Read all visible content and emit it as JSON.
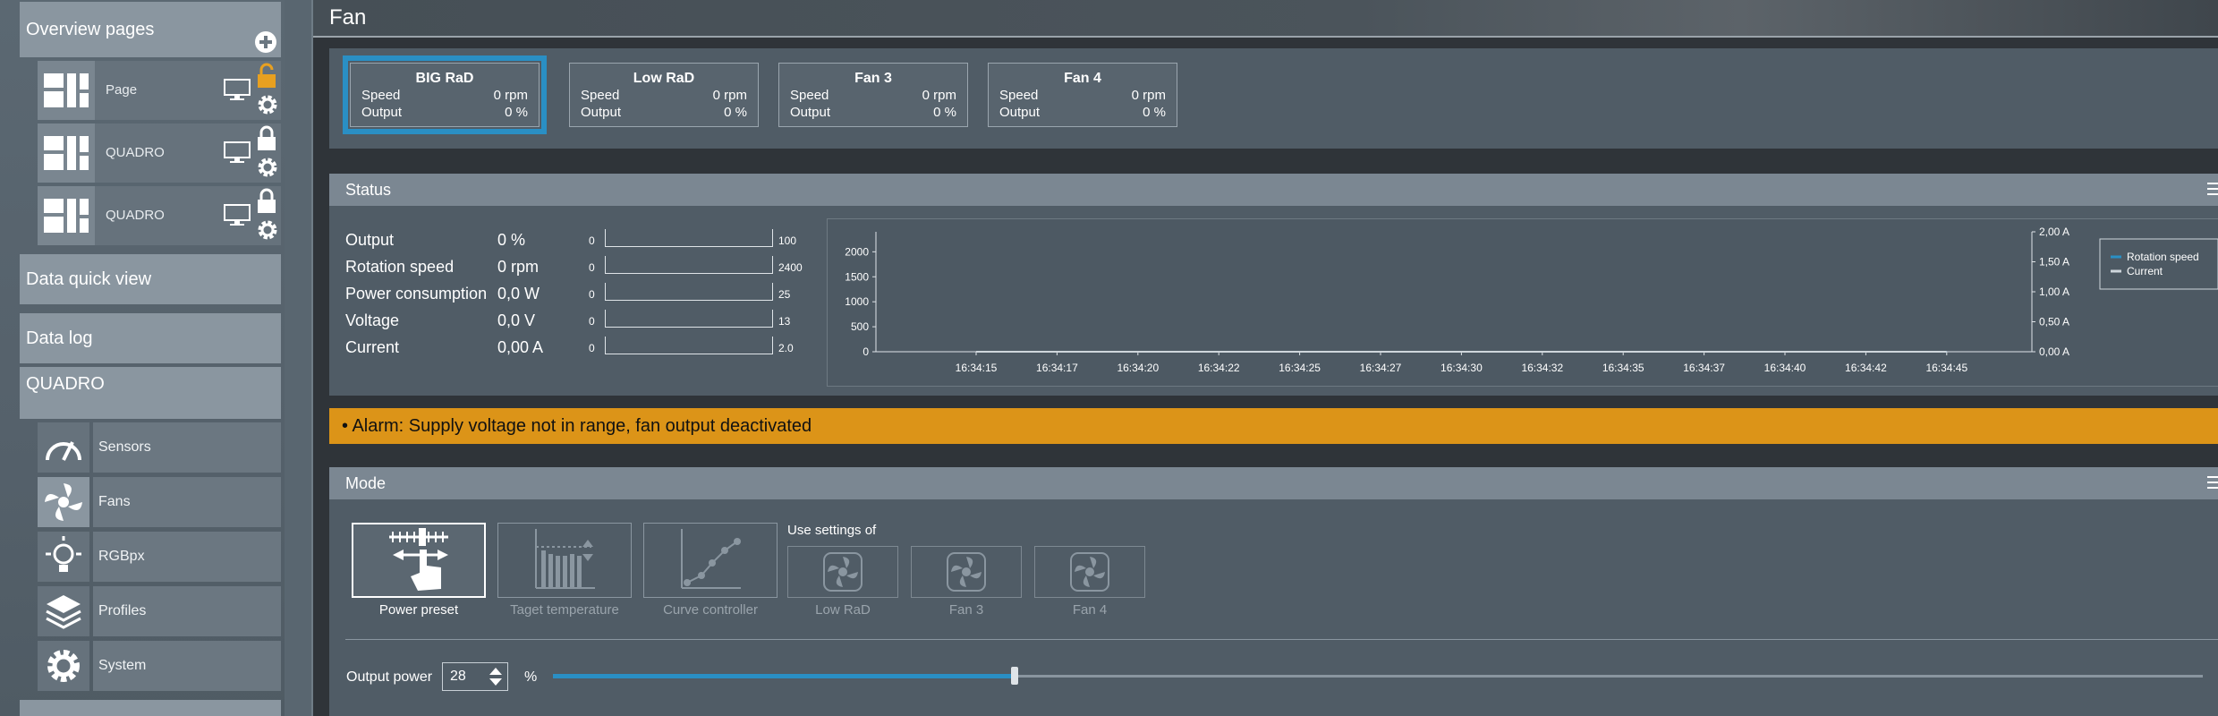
{
  "sidebar": {
    "overview_title": "Overview pages",
    "pages": [
      {
        "label": "Page"
      },
      {
        "label": "QUADRO"
      },
      {
        "label": "QUADRO"
      }
    ],
    "data_quick_view": "Data quick view",
    "data_log": "Data log",
    "device": "QUADRO",
    "items": [
      {
        "label": "Sensors",
        "icon": "gauge-icon"
      },
      {
        "label": "Fans",
        "icon": "fan-icon"
      },
      {
        "label": "RGBpx",
        "icon": "bulb-icon"
      },
      {
        "label": "Profiles",
        "icon": "layers-icon"
      },
      {
        "label": "System",
        "icon": "gear-icon"
      }
    ]
  },
  "header": {
    "title": "Fan"
  },
  "fans": [
    {
      "name": "BIG RaD",
      "speed_label": "Speed",
      "speed": "0 rpm",
      "output_label": "Output",
      "output": "0 %"
    },
    {
      "name": "Low RaD",
      "speed_label": "Speed",
      "speed": "0 rpm",
      "output_label": "Output",
      "output": "0 %"
    },
    {
      "name": "Fan 3",
      "speed_label": "Speed",
      "speed": "0 rpm",
      "output_label": "Output",
      "output": "0 %"
    },
    {
      "name": "Fan 4",
      "speed_label": "Speed",
      "speed": "0 rpm",
      "output_label": "Output",
      "output": "0 %"
    }
  ],
  "status": {
    "title": "Status",
    "rows": [
      {
        "label": "Output",
        "value": "0 %",
        "min": "0",
        "max": "100"
      },
      {
        "label": "Rotation speed",
        "value": "0 rpm",
        "min": "0",
        "max": "2400"
      },
      {
        "label": "Power consumption",
        "value": "0,0 W",
        "min": "0",
        "max": "25"
      },
      {
        "label": "Voltage",
        "value": "0,0 V",
        "min": "0",
        "max": "13"
      },
      {
        "label": "Current",
        "value": "0,00 A",
        "min": "0",
        "max": "2.0"
      }
    ]
  },
  "chart_data": {
    "type": "line",
    "x": [
      "16:34:15",
      "16:34:17",
      "16:34:20",
      "16:34:22",
      "16:34:25",
      "16:34:27",
      "16:34:30",
      "16:34:32",
      "16:34:35",
      "16:34:37",
      "16:34:40",
      "16:34:42",
      "16:34:45"
    ],
    "y_left_ticks": [
      "0",
      "500",
      "1000",
      "1500",
      "2000"
    ],
    "y_right_ticks": [
      "0,00 A",
      "0,50 A",
      "1,00 A",
      "1,50 A",
      "2,00 A"
    ],
    "ylim_left": [
      0,
      2400
    ],
    "ylim_right": [
      0,
      2
    ],
    "legend_position": "right",
    "series": [
      {
        "name": "Rotation speed",
        "color": "#2a8fc4",
        "values": [
          0,
          0,
          0,
          0,
          0,
          0,
          0,
          0,
          0,
          0,
          0,
          0,
          0
        ]
      },
      {
        "name": "Current",
        "color": "#cfd6dc",
        "values": [
          0,
          0,
          0,
          0,
          0,
          0,
          0,
          0,
          0,
          0,
          0,
          0,
          0
        ]
      }
    ]
  },
  "alarm": {
    "text": "• Alarm: Supply voltage not in range, fan output deactivated"
  },
  "mode": {
    "title": "Mode",
    "options": [
      {
        "label": "Power preset",
        "active": true
      },
      {
        "label": "Taget temperature",
        "active": false
      },
      {
        "label": "Curve controller",
        "active": false
      }
    ],
    "use_settings_label": "Use settings of",
    "use_settings": [
      {
        "label": "Low RaD"
      },
      {
        "label": "Fan 3"
      },
      {
        "label": "Fan 4"
      }
    ],
    "output_power_label": "Output power",
    "output_power_value": "28",
    "output_power_unit": "%",
    "slider_fraction": 0.28
  },
  "colors": {
    "accent": "#2a8fc4",
    "alarm": "#dc9418"
  }
}
